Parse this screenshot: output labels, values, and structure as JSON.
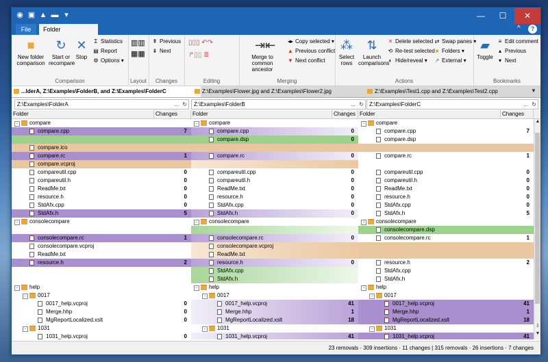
{
  "window": {
    "title_icons": [
      "app-icon",
      "save-icon",
      "lock-icon",
      "folder-icon"
    ],
    "min": "—",
    "max": "☐",
    "close": "✕"
  },
  "tabs": {
    "file": "File",
    "folder_comparisons": "Folder comparisons",
    "help": "?",
    "collapse": "^"
  },
  "ribbon": {
    "comparison": {
      "name": "Comparison",
      "new_folder": "New folder comparison",
      "start": "Start or recompare",
      "stop": "Stop",
      "statistics": "Statistics",
      "report": "Report",
      "options": "Options"
    },
    "layout": {
      "name": "Layout"
    },
    "changes": {
      "name": "Changes",
      "previous": "Previous",
      "next": "Next"
    },
    "editing": {
      "name": "Editing"
    },
    "merging": {
      "name": "Merging",
      "merge_common": "Merge to common ancestor",
      "copy_selected": "Copy selected",
      "previous_conflict": "Previous conflict",
      "next_conflict": "Next conflict"
    },
    "actions": {
      "name": "Actions",
      "select_rows": "Select rows",
      "launch": "Launch comparisons",
      "delete_selected": "Delete selected",
      "retest_selected": "Re-test selected",
      "hide_reveal": "Hide/reveal",
      "swap_panes": "Swap panes",
      "folders": "Folders",
      "external": "External"
    },
    "bookmarks": {
      "name": "Bookmarks",
      "toggle": "Toggle",
      "edit_comment": "Edit comment",
      "previous": "Previous",
      "next": "Next"
    }
  },
  "doc_tabs": [
    {
      "label": "...lderA, Z:\\Examples\\FolderB, and Z:\\Examples\\FolderC",
      "active": true
    },
    {
      "label": "Z:\\Examples\\Flower.jpg and Z:\\Examples\\Flower2.jpg",
      "active": false
    },
    {
      "label": "Z:\\Examples\\Test1.cpp and Z:\\Examples\\Test2.cpp",
      "active": false
    }
  ],
  "paths": [
    "Z:\\Examples\\FolderA",
    "Z:\\Examples\\FolderB",
    "Z:\\Examples\\FolderC"
  ],
  "path_dots": "...",
  "path_refresh": "↻",
  "columns": {
    "folder": "Folder",
    "changes": "Changes"
  },
  "rows": [
    {
      "cells": [
        {
          "t": "folder",
          "n": "compare",
          "ch": "",
          "ind": 0,
          "exp": "-"
        },
        {
          "t": "folder",
          "n": "compare",
          "ch": "",
          "ind": 0,
          "exp": "-"
        },
        {
          "t": "folder",
          "n": "compare",
          "ch": "",
          "ind": 0,
          "exp": "-"
        }
      ],
      "c": [
        "",
        "",
        ""
      ]
    },
    {
      "cells": [
        {
          "t": "src",
          "n": "compare.cpp",
          "ch": "7",
          "ind": 1
        },
        {
          "t": "file",
          "n": "compare.cpp",
          "ch": "0",
          "ind": 1
        },
        {
          "t": "file",
          "n": "compare.cpp",
          "ch": "7",
          "ind": 1
        }
      ],
      "c": [
        "mod",
        "fade-mod",
        ""
      ]
    },
    {
      "cells": [
        {
          "t": "",
          "n": "",
          "ch": "",
          "ind": 1
        },
        {
          "t": "file",
          "n": "compare.dsp",
          "ch": "0",
          "ind": 1
        },
        {
          "t": "file",
          "n": "compare.dsp",
          "ch": "",
          "ind": 1
        }
      ],
      "c": [
        "add",
        "add",
        ""
      ]
    },
    {
      "cells": [
        {
          "t": "file",
          "n": "compare.ico",
          "ch": "",
          "ind": 1
        },
        {
          "t": "",
          "n": "",
          "ch": "",
          "ind": 1
        },
        {
          "t": "",
          "n": "",
          "ch": "",
          "ind": 1
        }
      ],
      "c": [
        "rem",
        "rem",
        "rem"
      ]
    },
    {
      "cells": [
        {
          "t": "src",
          "n": "compare.rc",
          "ch": "1",
          "ind": 1
        },
        {
          "t": "file",
          "n": "compare.rc",
          "ch": "0",
          "ind": 1
        },
        {
          "t": "file",
          "n": "compare.rc",
          "ch": "1",
          "ind": 1
        }
      ],
      "c": [
        "mod",
        "fade-mod",
        ""
      ]
    },
    {
      "cells": [
        {
          "t": "file",
          "n": "compare.vcproj",
          "ch": "",
          "ind": 1
        },
        {
          "t": "",
          "n": "",
          "ch": "",
          "ind": 1
        },
        {
          "t": "",
          "n": "",
          "ch": "",
          "ind": 1
        }
      ],
      "c": [
        "rem",
        "fade-rem",
        ""
      ]
    },
    {
      "cells": [
        {
          "t": "file",
          "n": "compareutil.cpp",
          "ch": "0",
          "ind": 1
        },
        {
          "t": "file",
          "n": "compareutil.cpp",
          "ch": "0",
          "ind": 1
        },
        {
          "t": "file",
          "n": "compareutil.cpp",
          "ch": "0",
          "ind": 1
        }
      ],
      "c": [
        "",
        "",
        ""
      ]
    },
    {
      "cells": [
        {
          "t": "file",
          "n": "compareutil.h",
          "ch": "0",
          "ind": 1
        },
        {
          "t": "file",
          "n": "compareutil.h",
          "ch": "0",
          "ind": 1
        },
        {
          "t": "file",
          "n": "compareutil.h",
          "ch": "0",
          "ind": 1
        }
      ],
      "c": [
        "",
        "",
        ""
      ]
    },
    {
      "cells": [
        {
          "t": "file",
          "n": "ReadMe.txt",
          "ch": "0",
          "ind": 1
        },
        {
          "t": "file",
          "n": "ReadMe.txt",
          "ch": "0",
          "ind": 1
        },
        {
          "t": "file",
          "n": "ReadMe.txt",
          "ch": "0",
          "ind": 1
        }
      ],
      "c": [
        "",
        "",
        ""
      ]
    },
    {
      "cells": [
        {
          "t": "file",
          "n": "resource.h",
          "ch": "0",
          "ind": 1
        },
        {
          "t": "file",
          "n": "resource.h",
          "ch": "0",
          "ind": 1
        },
        {
          "t": "file",
          "n": "resource.h",
          "ch": "0",
          "ind": 1
        }
      ],
      "c": [
        "",
        "",
        ""
      ]
    },
    {
      "cells": [
        {
          "t": "file",
          "n": "StdAfx.cpp",
          "ch": "0",
          "ind": 1
        },
        {
          "t": "file",
          "n": "StdAfx.cpp",
          "ch": "0",
          "ind": 1
        },
        {
          "t": "file",
          "n": "StdAfx.cpp",
          "ch": "0",
          "ind": 1
        }
      ],
      "c": [
        "",
        "",
        ""
      ]
    },
    {
      "cells": [
        {
          "t": "src",
          "n": "StdAfx.h",
          "ch": "5",
          "ind": 1
        },
        {
          "t": "file",
          "n": "StdAfx.h",
          "ch": "0",
          "ind": 1
        },
        {
          "t": "file",
          "n": "StdAfx.h",
          "ch": "5",
          "ind": 1
        }
      ],
      "c": [
        "mod",
        "fade-mod",
        ""
      ]
    },
    {
      "cells": [
        {
          "t": "folder",
          "n": "consolecompare",
          "ch": "",
          "ind": 0,
          "exp": "-"
        },
        {
          "t": "folder",
          "n": "consolecompare",
          "ch": "",
          "ind": 0,
          "exp": "-"
        },
        {
          "t": "folder",
          "n": "consolecompare",
          "ch": "",
          "ind": 0,
          "exp": "-"
        }
      ],
      "c": [
        "",
        "",
        ""
      ]
    },
    {
      "cells": [
        {
          "t": "",
          "n": "",
          "ch": "",
          "ind": 1
        },
        {
          "t": "",
          "n": "",
          "ch": "",
          "ind": 1
        },
        {
          "t": "file",
          "n": "consolecompare.dsp",
          "ch": "",
          "ind": 1
        }
      ],
      "c": [
        "",
        "fade-add",
        "add"
      ]
    },
    {
      "cells": [
        {
          "t": "src",
          "n": "consolecompare.rc",
          "ch": "1",
          "ind": 1
        },
        {
          "t": "file",
          "n": "consolecompare.rc",
          "ch": "0",
          "ind": 1
        },
        {
          "t": "file",
          "n": "consolecompare.rc",
          "ch": "1",
          "ind": 1
        }
      ],
      "c": [
        "mod",
        "fade-mod",
        ""
      ]
    },
    {
      "cells": [
        {
          "t": "file",
          "n": "consolecompare.vcproj",
          "ch": "",
          "ind": 1
        },
        {
          "t": "file",
          "n": "consolecompare.vcproj",
          "ch": "",
          "ind": 1
        },
        {
          "t": "",
          "n": "",
          "ch": "",
          "ind": 1
        }
      ],
      "c": [
        "",
        "fade-rem",
        "rem"
      ]
    },
    {
      "cells": [
        {
          "t": "file",
          "n": "ReadMe.txt",
          "ch": "",
          "ind": 1
        },
        {
          "t": "file",
          "n": "ReadMe.txt",
          "ch": "",
          "ind": 1
        },
        {
          "t": "",
          "n": "",
          "ch": "",
          "ind": 1
        }
      ],
      "c": [
        "",
        "fade-rem",
        "rem"
      ]
    },
    {
      "cells": [
        {
          "t": "src",
          "n": "resource.h",
          "ch": "2",
          "ind": 1
        },
        {
          "t": "file",
          "n": "resource.h",
          "ch": "0",
          "ind": 1
        },
        {
          "t": "file",
          "n": "resource.h",
          "ch": "2",
          "ind": 1
        }
      ],
      "c": [
        "mod",
        "fade-mod",
        ""
      ]
    },
    {
      "cells": [
        {
          "t": "",
          "n": "",
          "ch": "",
          "ind": 1
        },
        {
          "t": "file",
          "n": "StdAfx.cpp",
          "ch": "",
          "ind": 1
        },
        {
          "t": "file",
          "n": "StdAfx.cpp",
          "ch": "",
          "ind": 1
        }
      ],
      "c": [
        "",
        "fade-add",
        ""
      ]
    },
    {
      "cells": [
        {
          "t": "",
          "n": "",
          "ch": "",
          "ind": 1
        },
        {
          "t": "file",
          "n": "StdAfx.h",
          "ch": "",
          "ind": 1
        },
        {
          "t": "file",
          "n": "StdAfx.h",
          "ch": "",
          "ind": 1
        }
      ],
      "c": [
        "",
        "fade-add",
        ""
      ]
    },
    {
      "cells": [
        {
          "t": "folder",
          "n": "help",
          "ch": "",
          "ind": 0,
          "exp": "-"
        },
        {
          "t": "folder",
          "n": "help",
          "ch": "",
          "ind": 0,
          "exp": "-"
        },
        {
          "t": "folder",
          "n": "help",
          "ch": "",
          "ind": 0,
          "exp": "-"
        }
      ],
      "c": [
        "",
        "",
        ""
      ]
    },
    {
      "cells": [
        {
          "t": "folder",
          "n": "0017",
          "ch": "",
          "ind": 1,
          "exp": "-"
        },
        {
          "t": "folder",
          "n": "0017",
          "ch": "",
          "ind": 1,
          "exp": "-"
        },
        {
          "t": "folder",
          "n": "0017",
          "ch": "",
          "ind": 1,
          "exp": "-"
        }
      ],
      "c": [
        "",
        "",
        ""
      ]
    },
    {
      "cells": [
        {
          "t": "file",
          "n": "0017_help.vcproj",
          "ch": "0",
          "ind": 2
        },
        {
          "t": "file",
          "n": "0017_help.vcproj",
          "ch": "41",
          "ind": 2
        },
        {
          "t": "src",
          "n": "0017_help.vcproj",
          "ch": "41",
          "ind": 2
        }
      ],
      "c": [
        "",
        "fade-mod-r",
        "mod"
      ]
    },
    {
      "cells": [
        {
          "t": "file",
          "n": "Merge.hhp",
          "ch": "0",
          "ind": 2
        },
        {
          "t": "file",
          "n": "Merge.hhp",
          "ch": "1",
          "ind": 2
        },
        {
          "t": "src",
          "n": "Merge.hhp",
          "ch": "1",
          "ind": 2
        }
      ],
      "c": [
        "",
        "fade-mod-r",
        "mod"
      ]
    },
    {
      "cells": [
        {
          "t": "file",
          "n": "MgReportLocalized.xslt",
          "ch": "0",
          "ind": 2
        },
        {
          "t": "file",
          "n": "MgReportLocalized.xslt",
          "ch": "18",
          "ind": 2
        },
        {
          "t": "src",
          "n": "MgReportLocalized.xslt",
          "ch": "18",
          "ind": 2
        }
      ],
      "c": [
        "",
        "fade-mod-r",
        "mod"
      ]
    },
    {
      "cells": [
        {
          "t": "folder",
          "n": "1031",
          "ch": "",
          "ind": 1,
          "exp": "-"
        },
        {
          "t": "folder",
          "n": "1031",
          "ch": "",
          "ind": 1,
          "exp": "-"
        },
        {
          "t": "folder",
          "n": "1031",
          "ch": "",
          "ind": 1,
          "exp": "-"
        }
      ],
      "c": [
        "",
        "",
        ""
      ]
    },
    {
      "cells": [
        {
          "t": "file",
          "n": "1031_help.vcproj",
          "ch": "0",
          "ind": 2
        },
        {
          "t": "file",
          "n": "1031_help.vcproj",
          "ch": "41",
          "ind": 2
        },
        {
          "t": "src",
          "n": "1031_help.vcproj",
          "ch": "41",
          "ind": 2
        }
      ],
      "c": [
        "",
        "fade-mod-r",
        "mod"
      ]
    }
  ],
  "status": "23 removals · 309 insertions · 11 changes | 315 removals · 26 insertions · 7 changes"
}
